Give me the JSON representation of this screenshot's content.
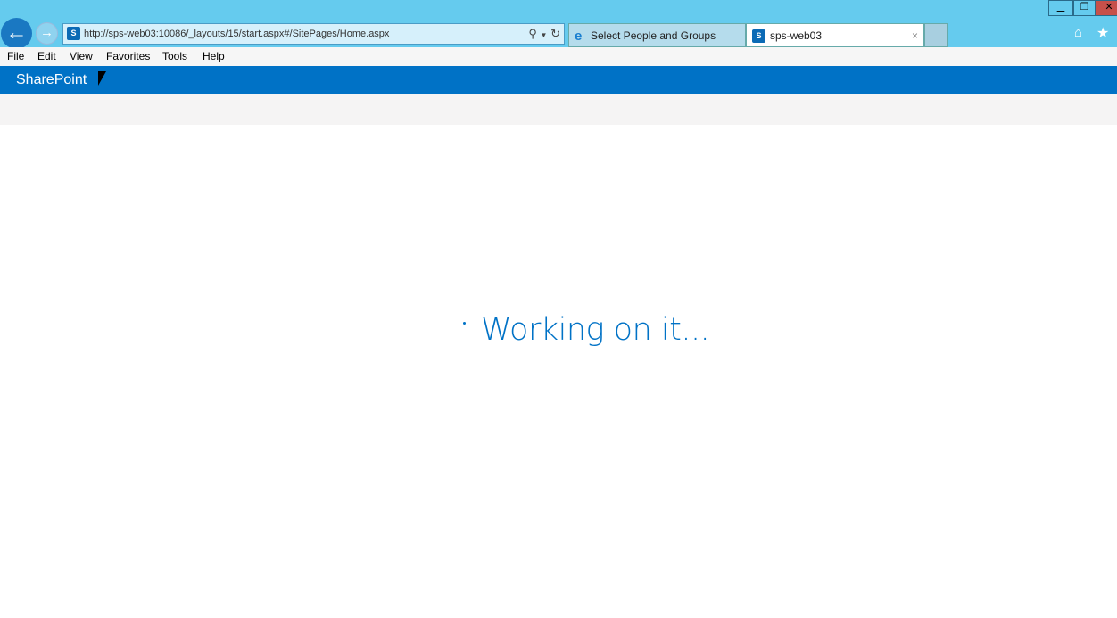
{
  "browser": {
    "address": "http://sps-web03:10086/_layouts/15/start.aspx#/SitePages/Home.aspx",
    "tabs": [
      {
        "label": "Select People and Groups",
        "icon": "ie-icon",
        "active": false
      },
      {
        "label": "sps-web03",
        "icon": "sharepoint-icon",
        "active": true
      }
    ],
    "window_buttons": {
      "minimize": "▁",
      "restore": "❐",
      "close": "✕"
    },
    "tab_close": "×",
    "sp_icon": "S",
    "ie_icon": "e"
  },
  "menu": [
    "File",
    "Edit",
    "View",
    "Favorites",
    "Tools",
    "Help"
  ],
  "suite_bar": {
    "brand": "SharePoint",
    "color": "#0072c6"
  },
  "main": {
    "status": "Working on it..."
  }
}
